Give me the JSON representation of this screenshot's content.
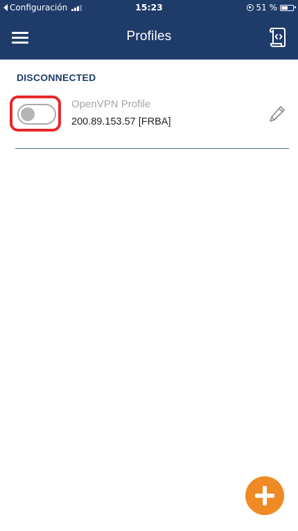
{
  "status_bar": {
    "back_label": "Configuración",
    "time": "15:23",
    "battery_text": "51 %",
    "battery_level": 0.51
  },
  "header": {
    "title": "Profiles"
  },
  "section": {
    "title": "DISCONNECTED"
  },
  "profile": {
    "name": "OpenVPN Profile",
    "server": "200.89.153.57 [FRBA]",
    "connected": false
  },
  "icons": {
    "menu": "hamburger-menu-icon",
    "import": "import-file-icon",
    "edit": "pencil-icon",
    "add": "plus-icon"
  },
  "colors": {
    "header_bg": "#1f3b6a",
    "accent": "#ef8a25",
    "highlight": "#e8272c"
  }
}
